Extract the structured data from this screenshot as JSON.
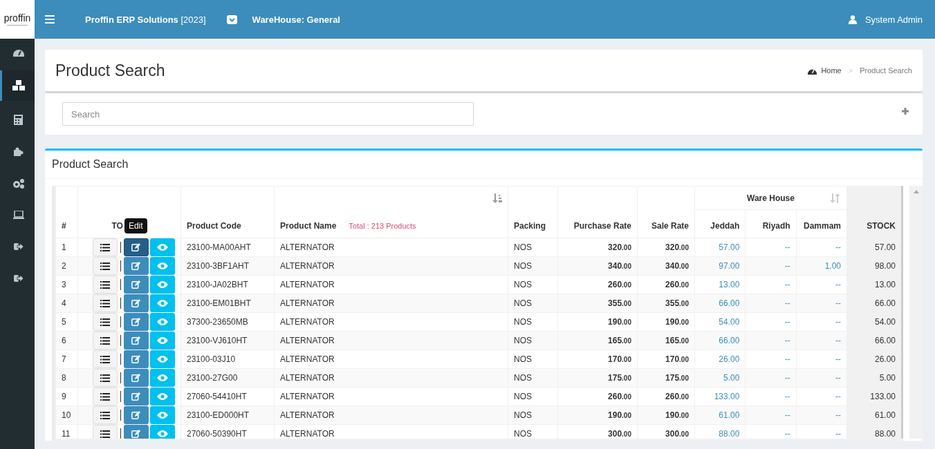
{
  "topbar": {
    "logo": "proffin",
    "brand": "Proffin ERP Solutions",
    "year": "[2023]",
    "warehouse": "WareHouse: General",
    "user": "System Admin"
  },
  "sidebar": {
    "items": [
      {
        "selected": false
      },
      {
        "selected": true
      },
      {
        "selected": false
      },
      {
        "selected": false
      },
      {
        "selected": false
      },
      {
        "selected": false
      },
      {
        "selected": false
      },
      {
        "selected": false
      }
    ]
  },
  "page_header": {
    "title": "Product Search",
    "breadcrumb": [
      {
        "label": "Home"
      },
      {
        "label": "Product Search"
      }
    ],
    "separator": ">"
  },
  "search": {
    "placeholder": "Search"
  },
  "box": {
    "title": "Product Search",
    "table": {
      "group_header": "Ware House",
      "total": "Total : 213 Products",
      "tooltip": "Edit",
      "columns": [
        "#",
        "TO",
        "Product Code",
        "Product Name",
        "Packing",
        "Purchase Rate",
        "Sale Rate",
        "Jeddah",
        "Riyadh",
        "Dammam",
        "STOCK"
      ],
      "rows": [
        {
          "no": "1",
          "edit_hovered": true,
          "code": "23100-MA00AHT",
          "name": "ALTERNATOR",
          "packing": "NOS",
          "purchase": "320.00",
          "sale": "320.00",
          "jeddah": "57.00",
          "riyadh": "--",
          "dammam": "--",
          "stock": "57.00"
        },
        {
          "no": "2",
          "edit_hovered": false,
          "code": "23100-3BF1AHT",
          "name": "ALTERNATOR",
          "packing": "NOS",
          "purchase": "340.00",
          "sale": "340.00",
          "jeddah": "97.00",
          "riyadh": "--",
          "dammam": "1.00",
          "stock": "98.00"
        },
        {
          "no": "3",
          "edit_hovered": false,
          "code": "23100-JA02BHT",
          "name": "ALTERNATOR",
          "packing": "NOS",
          "purchase": "260.00",
          "sale": "260.00",
          "jeddah": "13.00",
          "riyadh": "--",
          "dammam": "--",
          "stock": "13.00"
        },
        {
          "no": "4",
          "edit_hovered": false,
          "code": "23100-EM01BHT",
          "name": "ALTERNATOR",
          "packing": "NOS",
          "purchase": "355.00",
          "sale": "355.00",
          "jeddah": "66.00",
          "riyadh": "--",
          "dammam": "--",
          "stock": "66.00"
        },
        {
          "no": "5",
          "edit_hovered": false,
          "code": "37300-23650MB",
          "name": "ALTERNATOR",
          "packing": "NOS",
          "purchase": "190.00",
          "sale": "190.00",
          "jeddah": "54.00",
          "riyadh": "--",
          "dammam": "--",
          "stock": "54.00"
        },
        {
          "no": "6",
          "edit_hovered": false,
          "code": "23100-VJ610HT",
          "name": "ALTERNATOR",
          "packing": "NOS",
          "purchase": "165.00",
          "sale": "165.00",
          "jeddah": "66.00",
          "riyadh": "--",
          "dammam": "--",
          "stock": "66.00"
        },
        {
          "no": "7",
          "edit_hovered": false,
          "code": "23100-03J10",
          "name": "ALTERNATOR",
          "packing": "NOS",
          "purchase": "170.00",
          "sale": "170.00",
          "jeddah": "26.00",
          "riyadh": "--",
          "dammam": "--",
          "stock": "26.00"
        },
        {
          "no": "8",
          "edit_hovered": false,
          "code": "23100-27G00",
          "name": "ALTERNATOR",
          "packing": "NOS",
          "purchase": "175.00",
          "sale": "175.00",
          "jeddah": "5.00",
          "riyadh": "--",
          "dammam": "--",
          "stock": "5.00"
        },
        {
          "no": "9",
          "edit_hovered": false,
          "code": "27060-54410HT",
          "name": "ALTERNATOR",
          "packing": "NOS",
          "purchase": "260.00",
          "sale": "260.00",
          "jeddah": "133.00",
          "riyadh": "--",
          "dammam": "--",
          "stock": "133.00"
        },
        {
          "no": "10",
          "edit_hovered": false,
          "code": "23100-ED000HT",
          "name": "ALTERNATOR",
          "packing": "NOS",
          "purchase": "190.00",
          "sale": "190.00",
          "jeddah": "61.00",
          "riyadh": "--",
          "dammam": "--",
          "stock": "61.00"
        },
        {
          "no": "11",
          "edit_hovered": false,
          "code": "27060-50390HT",
          "name": "ALTERNATOR",
          "packing": "NOS",
          "purchase": "300.00",
          "sale": "300.00",
          "jeddah": "88.00",
          "riyadh": "--",
          "dammam": "--",
          "stock": "88.00"
        }
      ]
    }
  }
}
